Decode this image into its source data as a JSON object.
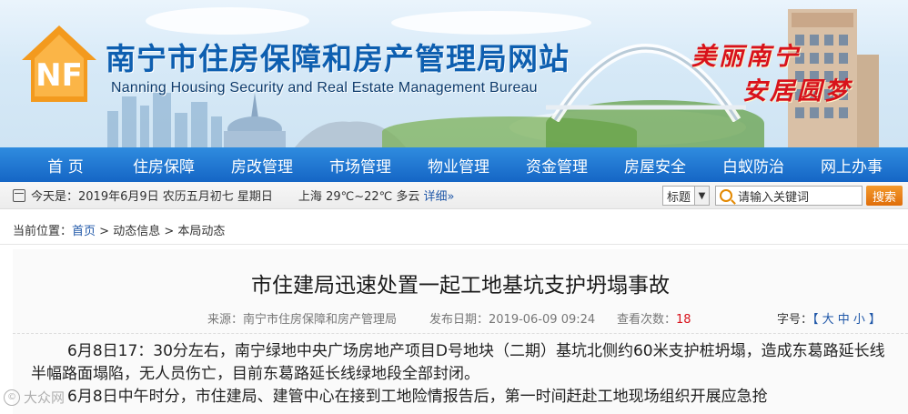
{
  "header": {
    "logo_text": "NF",
    "title_cn": "南宁市住房保障和房产管理局网站",
    "title_en": "Nanning Housing Security and Real Estate Management Bureau",
    "slogan_line1": "美丽南宁",
    "slogan_line2": "安居圆梦"
  },
  "nav": {
    "items": [
      "首 页",
      "住房保障",
      "房改管理",
      "市场管理",
      "物业管理",
      "资金管理",
      "房屋安全",
      "白蚁防治",
      "网上办事"
    ]
  },
  "infobar": {
    "date": "今天是：2019年6月9日 农历五月初七 星期日",
    "weather_city": "上海",
    "weather_temp": "29℃~22℃",
    "weather_cond": "多云",
    "weather_detail": "详细»",
    "select_value": "标题",
    "search_placeholder": "请输入关键词",
    "search_button": "搜索"
  },
  "breadcrumb": {
    "prefix": "当前位置：",
    "home": "首页",
    "rest": " > 动态信息 > 本局动态"
  },
  "article": {
    "title": "市住建局迅速处置一起工地基坑支护坍塌事故",
    "source_label": "来源：",
    "source": "南宁市住房保障和房产管理局",
    "date_label": "发布日期：",
    "date": "2019-06-09 09:24",
    "views_label": "查看次数：",
    "views": "18",
    "fontsize_label": "字号：",
    "fontsize_options": "【 大 中 小 】",
    "paragraphs": [
      "6月8日17：30分左右，南宁绿地中央广场房地产项目D号地块（二期）基坑北侧约60米支护桩坍塌，造成东葛路延长线半幅路面塌陷，无人员伤亡，目前东葛路延长线绿地段全部封闭。",
      "6月8日中午时分，市住建局、建管中心在接到工地险情报告后，第一时间赶赴工地现场组织开展应急抢"
    ]
  },
  "watermark": "大众网"
}
